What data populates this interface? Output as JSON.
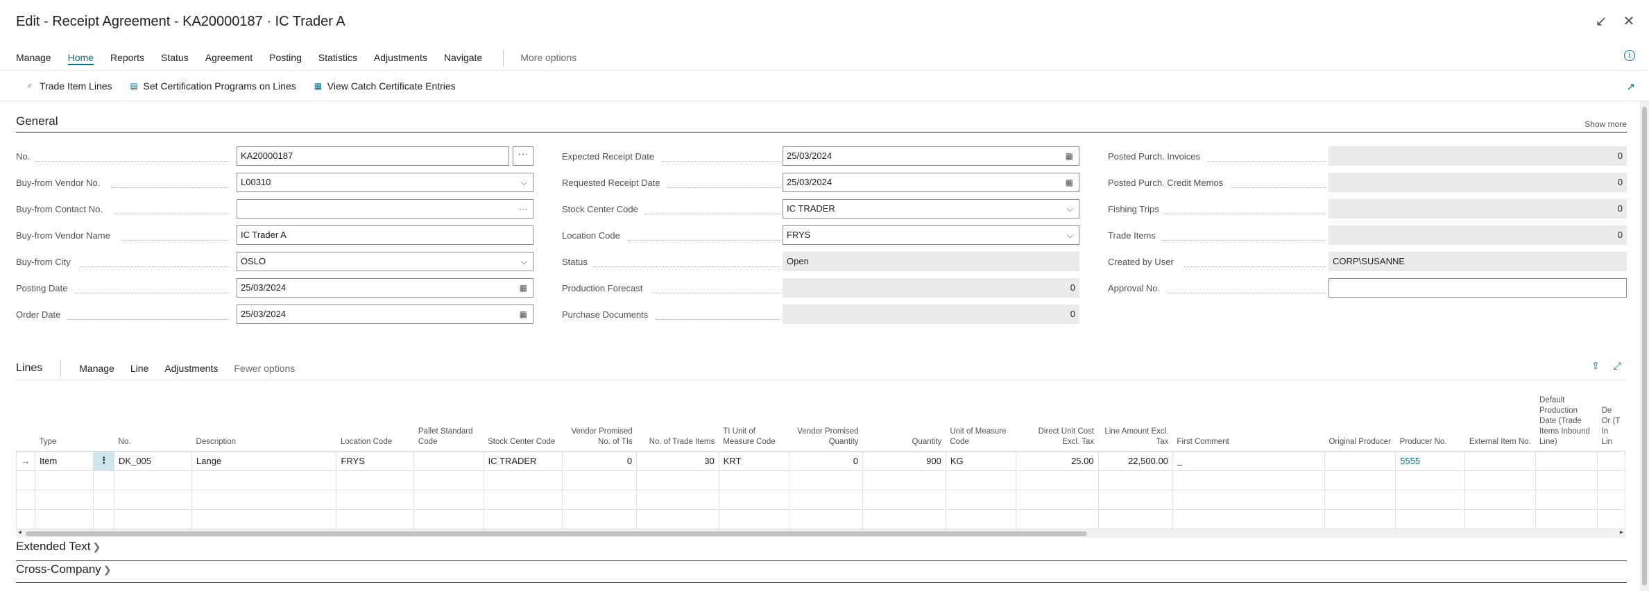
{
  "window": {
    "title": "Edit - Receipt Agreement - KA20000187 · IC Trader A",
    "collapse_glyph": "↙",
    "close_glyph": "✕"
  },
  "menu": {
    "items": [
      "Manage",
      "Home",
      "Reports",
      "Status",
      "Agreement",
      "Posting",
      "Statistics",
      "Adjustments",
      "Navigate"
    ],
    "active": "Home",
    "more": "More options",
    "info_glyph": "i"
  },
  "actions": {
    "items": [
      {
        "label": "Trade Item Lines",
        "icon": "people-icon",
        "glyph": "♂"
      },
      {
        "label": "Set Certification Programs on Lines",
        "icon": "certificate-icon",
        "glyph": "▤"
      },
      {
        "label": "View Catch Certificate Entries",
        "icon": "grid-list-icon",
        "glyph": "▦"
      }
    ],
    "pin_glyph": "↗"
  },
  "general": {
    "title": "General",
    "show_more": "Show more",
    "col1": [
      {
        "label": "No.",
        "value": "KA20000187",
        "kind": "text-ellipsis"
      },
      {
        "label": "Buy-from Vendor No.",
        "value": "L00310",
        "kind": "dropdown"
      },
      {
        "label": "Buy-from Contact No.",
        "value": "",
        "kind": "lookup"
      },
      {
        "label": "Buy-from Vendor Name",
        "value": "IC Trader A",
        "kind": "text"
      },
      {
        "label": "Buy-from City",
        "value": "OSLO",
        "kind": "dropdown"
      },
      {
        "label": "Posting Date",
        "value": "25/03/2024",
        "kind": "date"
      },
      {
        "label": "Order Date",
        "value": "25/03/2024",
        "kind": "date"
      }
    ],
    "col2": [
      {
        "label": "Expected Receipt Date",
        "value": "25/03/2024",
        "kind": "date"
      },
      {
        "label": "Requested Receipt Date",
        "value": "25/03/2024",
        "kind": "date"
      },
      {
        "label": "Stock Center Code",
        "value": "IC TRADER",
        "kind": "dropdown"
      },
      {
        "label": "Location Code",
        "value": "FRYS",
        "kind": "dropdown"
      },
      {
        "label": "Status",
        "value": "Open",
        "kind": "readonly"
      },
      {
        "label": "Production Forecast",
        "value": "0",
        "kind": "readonly-num"
      },
      {
        "label": "Purchase Documents",
        "value": "0",
        "kind": "readonly-num"
      }
    ],
    "col3": [
      {
        "label": "Posted Purch. Invoices",
        "value": "0",
        "kind": "readonly-num"
      },
      {
        "label": "Posted Purch. Credit Memos",
        "value": "0",
        "kind": "readonly-num"
      },
      {
        "label": "Fishing Trips",
        "value": "0",
        "kind": "readonly-num"
      },
      {
        "label": "Trade Items",
        "value": "0",
        "kind": "readonly-num"
      },
      {
        "label": "Created by User",
        "value": "CORP\\SUSANNE",
        "kind": "readonly"
      },
      {
        "label": "Approval No.",
        "value": "",
        "kind": "text"
      }
    ]
  },
  "lines": {
    "title": "Lines",
    "menu": [
      "Manage",
      "Line",
      "Adjustments"
    ],
    "fewer": "Fewer options",
    "columns": [
      {
        "key": "arrow",
        "label": "",
        "w": 27
      },
      {
        "key": "type",
        "label": "Type",
        "w": 85
      },
      {
        "key": "menu",
        "label": "",
        "w": 30
      },
      {
        "key": "no",
        "label": "No.",
        "w": 113
      },
      {
        "key": "description",
        "label": "Description",
        "w": 211
      },
      {
        "key": "location",
        "label": "Location Code",
        "w": 113
      },
      {
        "key": "pallet",
        "label": "Pallet Standard Code",
        "w": 101
      },
      {
        "key": "stock",
        "label": "Stock Center Code",
        "w": 114
      },
      {
        "key": "vendor_tis",
        "label": "Vendor Promised No. of TIs",
        "w": 108,
        "align": "r"
      },
      {
        "key": "trade_items",
        "label": "No. of Trade Items",
        "w": 120,
        "align": "r"
      },
      {
        "key": "ti_uom",
        "label": "TI Unit of Measure Code",
        "w": 102
      },
      {
        "key": "vendor_qty",
        "label": "Vendor Promised Quantity",
        "w": 107,
        "align": "r"
      },
      {
        "key": "quantity",
        "label": "Quantity",
        "w": 121,
        "align": "r"
      },
      {
        "key": "uom",
        "label": "Unit of Measure Code",
        "w": 102
      },
      {
        "key": "cost",
        "label": "Direct Unit Cost Excl. Tax",
        "w": 120,
        "align": "r"
      },
      {
        "key": "amount",
        "label": "Line Amount Excl. Tax",
        "w": 108,
        "align": "r"
      },
      {
        "key": "comment",
        "label": "First Comment",
        "w": 222
      },
      {
        "key": "orig_producer",
        "label": "Original Producer",
        "w": 103
      },
      {
        "key": "producer",
        "label": "Producer No.",
        "w": 101
      },
      {
        "key": "ext_item",
        "label": "External Item No.",
        "w": 102
      },
      {
        "key": "prod_date",
        "label": "Default Production Date (Trade Items Inbound Line)",
        "w": 90
      },
      {
        "key": "cut",
        "label": "De Or (T In Lin",
        "w": 40
      }
    ],
    "rows": [
      {
        "arrow": "→",
        "type": "Item",
        "menu": "⋮",
        "no": "DK_005",
        "description": "Lange",
        "location": "FRYS",
        "pallet": "",
        "stock": "IC TRADER",
        "vendor_tis": "0",
        "trade_items": "30",
        "ti_uom": "KRT",
        "vendor_qty": "0",
        "quantity": "900",
        "uom": "KG",
        "cost": "25.00",
        "amount": "22,500.00",
        "comment": "_",
        "orig_producer": "",
        "producer": "5555",
        "ext_item": "",
        "prod_date": "",
        "cut": ""
      }
    ],
    "empty_rows": 3
  },
  "fasttabs": [
    "Extended Text",
    "Cross-Company"
  ]
}
